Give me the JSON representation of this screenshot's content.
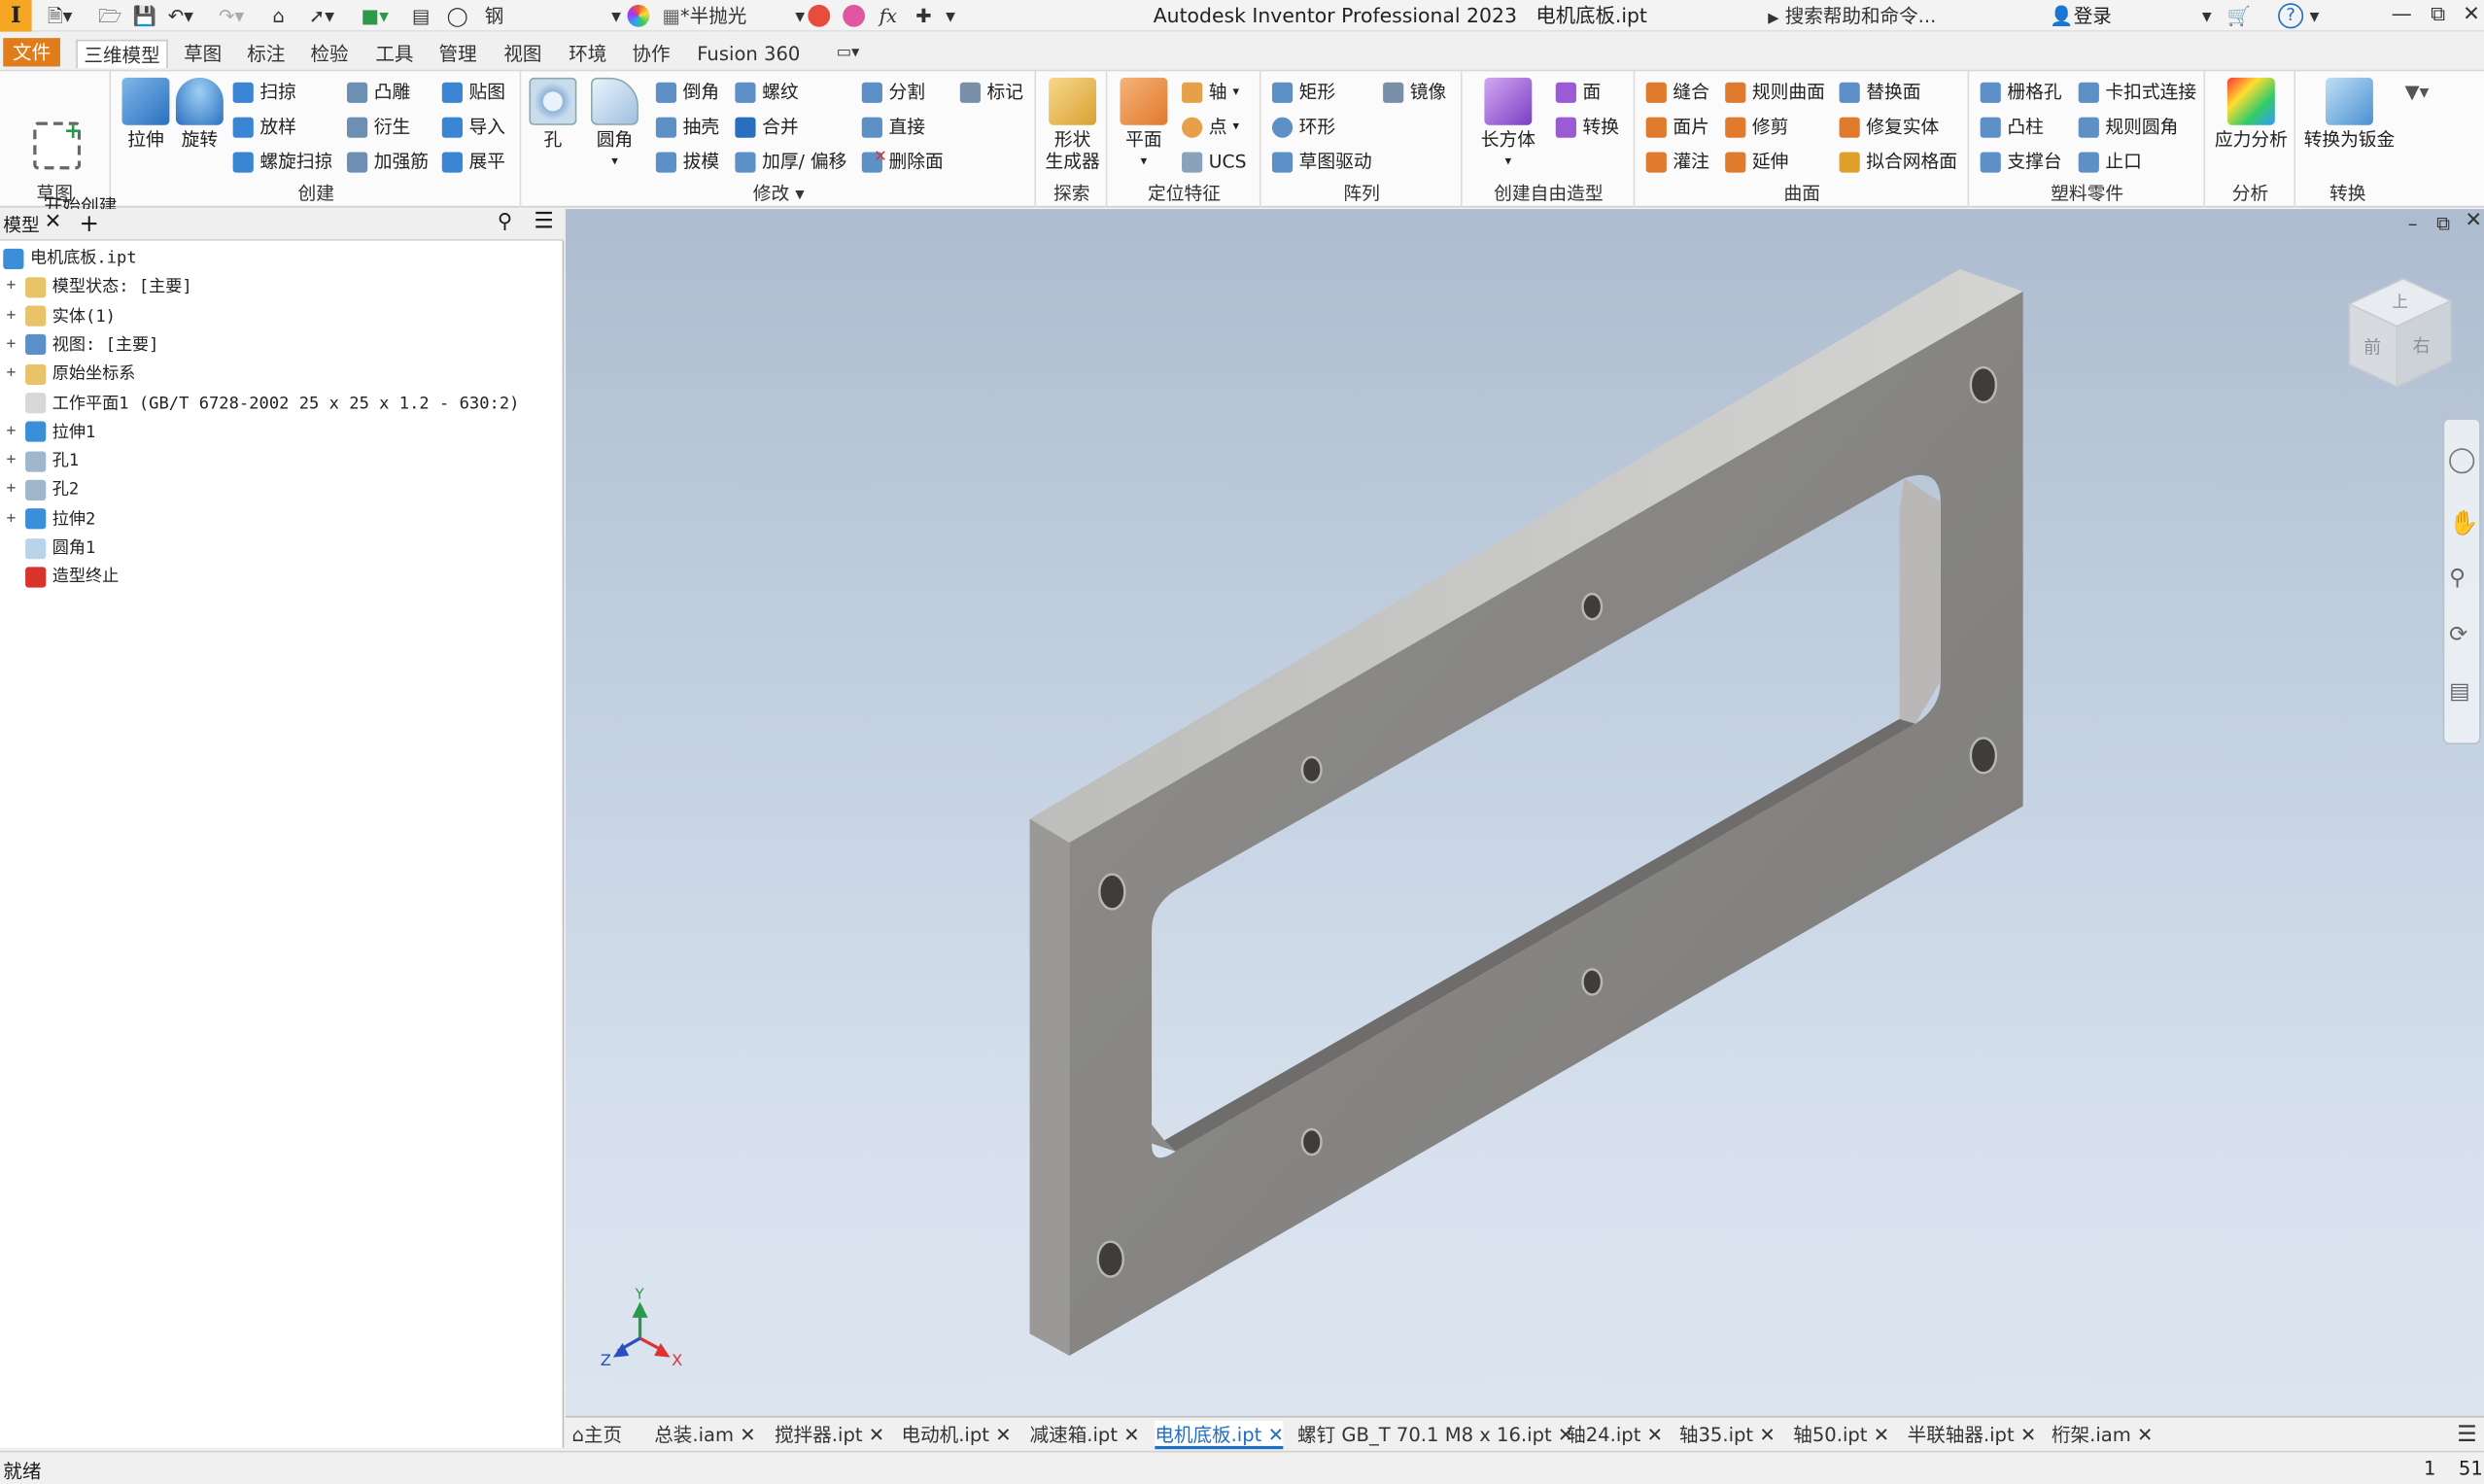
{
  "titlebar": {
    "app_logo": "I",
    "material": "钢",
    "appearance": "*半抛光",
    "fx": "fx",
    "title": "Autodesk Inventor Professional 2023",
    "document": "电机底板.ipt",
    "help_search": "搜索帮助和命令...",
    "login": "登录"
  },
  "tabs": {
    "file": "文件",
    "items": [
      "三维模型",
      "草图",
      "标注",
      "检验",
      "工具",
      "管理",
      "视图",
      "环境",
      "协作",
      "Fusion 360"
    ]
  },
  "ribbon": {
    "groups": {
      "sketch": "草图",
      "create": "创建",
      "modify": "修改",
      "explore": "探索",
      "work": "定位特征",
      "pattern": "阵列",
      "freeform": "创建自由造型",
      "surface": "曲面",
      "plastic": "塑料零件",
      "analysis": "分析",
      "convert": "转换"
    },
    "start_sketch": "开始创建\n二维草图",
    "extrude": "拉伸",
    "revolve": "旋转",
    "sweep": "扫掠",
    "loft": "放样",
    "coil": "螺旋扫掠",
    "emboss": "凸雕",
    "derive": "衍生",
    "rib": "加强筋",
    "decal": "贴图",
    "import": "导入",
    "unwrap": "展平",
    "hole": "孔",
    "fillet": "圆角",
    "chamfer": "倒角",
    "shell": "抽壳",
    "draft": "拔模",
    "thread": "螺纹",
    "combine": "合并",
    "thicken": "加厚/ 偏移",
    "split": "分割",
    "direct": "直接",
    "delete_face": "删除面",
    "mark": "标记",
    "shape_gen": "形状\n生成器",
    "plane": "平面",
    "axis": "轴",
    "point": "点",
    "ucs": "UCS",
    "rect": "矩形",
    "circular": "环形",
    "sketch_driven": "草图驱动",
    "mirror": "镜像",
    "box": "长方体",
    "face": "面",
    "convert": "转换",
    "stitch": "缝合",
    "ruled": "规则曲面",
    "replace_face": "替换面",
    "patch": "面片",
    "trim": "修剪",
    "repair": "修复实体",
    "sculpt": "灌注",
    "extend": "延伸",
    "fit_mesh": "拟合网格面",
    "grill": "栅格孔",
    "snap_fit": "卡扣式连接",
    "boss": "凸柱",
    "rule_fillet": "规则圆角",
    "rest": "支撑台",
    "lip": "止口",
    "stress": "应力分析",
    "to_sheet": "转换为钣金"
  },
  "panel": {
    "tab": "模型",
    "items": [
      {
        "label": "电机底板.ipt",
        "indent": 0,
        "expand": "",
        "icon": "#3b8fd9"
      },
      {
        "label": "模型状态: [主要]",
        "indent": 1,
        "expand": "+",
        "icon": "#e8c36a"
      },
      {
        "label": "实体(1)",
        "indent": 1,
        "expand": "+",
        "icon": "#e8c36a"
      },
      {
        "label": "视图: [主要]",
        "indent": 1,
        "expand": "+",
        "icon": "#5a8fc8"
      },
      {
        "label": "原始坐标系",
        "indent": 1,
        "expand": "+",
        "icon": "#e8c36a"
      },
      {
        "label": "工作平面1 (GB/T 6728-2002 25 x 25 x 1.2 - 630:2)",
        "indent": 1,
        "expand": "",
        "icon": "#d8d8d8"
      },
      {
        "label": "拉伸1",
        "indent": 1,
        "expand": "+",
        "icon": "#3b8fd9"
      },
      {
        "label": "孔1",
        "indent": 1,
        "expand": "+",
        "icon": "#9fb6cc"
      },
      {
        "label": "孔2",
        "indent": 1,
        "expand": "+",
        "icon": "#9fb6cc"
      },
      {
        "label": "拉伸2",
        "indent": 1,
        "expand": "+",
        "icon": "#3b8fd9"
      },
      {
        "label": "圆角1",
        "indent": 1,
        "expand": "",
        "icon": "#b9d3ea"
      },
      {
        "label": "造型终止",
        "indent": 1,
        "expand": "",
        "icon": "#d9342b"
      }
    ]
  },
  "viewcube": {
    "top": "上",
    "front": "前",
    "right": "右"
  },
  "axes": {
    "x": "X",
    "y": "Y",
    "z": "Z"
  },
  "doctabs": {
    "home": "主页",
    "items": [
      "总装.iam",
      "搅拌器.ipt",
      "电动机.ipt",
      "减速箱.ipt",
      "电机底板.ipt",
      "螺钉 GB_T 70.1 M8 x 16.ipt",
      "轴24.ipt",
      "轴35.ipt",
      "轴50.ipt",
      "半联轴器.ipt",
      "桁架.iam"
    ],
    "active": "电机底板.ipt"
  },
  "status": {
    "text": "就绪",
    "n1": "1",
    "n2": "51"
  }
}
